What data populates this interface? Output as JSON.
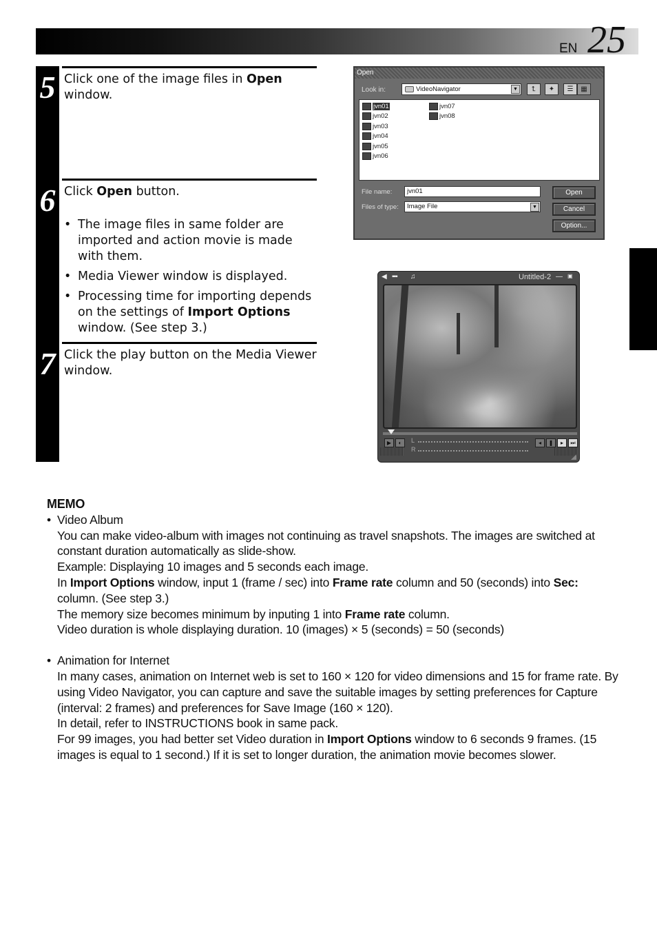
{
  "header": {
    "lang": "EN",
    "page_number": "25"
  },
  "steps": [
    {
      "number": "5",
      "text_parts": [
        "Click one of the image files in ",
        "Open",
        " window."
      ]
    },
    {
      "number": "6",
      "text_parts": [
        "Click ",
        "Open",
        " button."
      ],
      "bullets": [
        "The image files in same folder are imported and action movie is made with them.",
        "Media Viewer window is displayed.",
        [
          "Processing time for importing depends on the settings of ",
          "Import Options",
          " window. (See step 3.)"
        ]
      ]
    },
    {
      "number": "7",
      "text": "Click the play button on the Media Viewer window."
    }
  ],
  "open_dialog": {
    "title": "Open",
    "look_in_label": "Look in:",
    "look_in_value": "VideoNavigator",
    "toolbar_icons": [
      "up-folder-icon",
      "new-folder-icon",
      "list-view-icon",
      "details-view-icon"
    ],
    "files": [
      "jvn01",
      "jvn02",
      "jvn03",
      "jvn04",
      "jvn05",
      "jvn06",
      "jvn07",
      "jvn08"
    ],
    "selected_file": "jvn01",
    "file_name_label": "File name:",
    "file_name_value": "jvn01",
    "file_type_label": "Files of type:",
    "file_type_value": "Image File",
    "buttons": {
      "open": "Open",
      "cancel": "Cancel",
      "option": "Option..."
    }
  },
  "media_viewer": {
    "title": "Untitled-2",
    "minimize": "—",
    "meter_left": "L",
    "meter_right": "R"
  },
  "memo": {
    "title": "MEMO",
    "sections": [
      {
        "heading": "Video Album",
        "line1": "You can make video-album with images not continuing as travel snapshots. The images are switched at constant duration automatically as slide-show.",
        "line2": "Example: Displaying 10 images and 5 seconds each image.",
        "line3_parts": [
          "In ",
          "Import Options",
          " window, input 1 (frame / sec) into ",
          "Frame rate",
          " column and 50 (seconds) into ",
          "Sec:",
          " column. (See step 3.)"
        ],
        "line4_parts": [
          "The memory size becomes minimum by inputing 1 into ",
          "Frame rate",
          " column."
        ],
        "line5": "Video duration is whole displaying duration. 10 (images) × 5 (seconds) = 50 (seconds)"
      },
      {
        "heading": "Animation for Internet",
        "line1": "In many cases, animation on Internet web is set to 160 × 120 for video dimensions and 15 for frame rate. By using Video Navigator, you can capture and save the suitable images by setting preferences for Capture (interval: 2 frames) and preferences for Save Image (160 × 120).",
        "line2": "In detail, refer to INSTRUCTIONS book in same pack.",
        "line3_parts": [
          "For 99 images, you had better set Video duration in ",
          "Import Options",
          " window to 6 seconds 9 frames. (15 images is equal to 1 second.) If it is set to longer duration, the animation movie becomes slower."
        ]
      }
    ]
  }
}
